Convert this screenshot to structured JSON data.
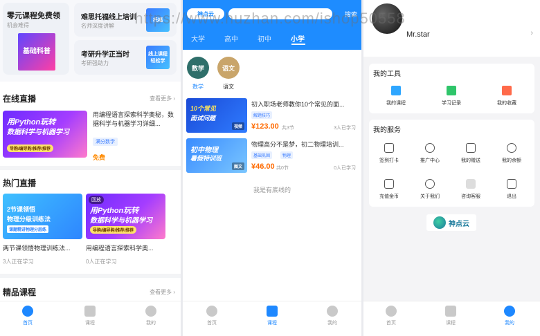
{
  "watermark": "https://www.huzhan.com/ishop50558",
  "screen1": {
    "top_cards": {
      "free": {
        "title": "零元课程免费领",
        "sub": "机会难得",
        "img": "基础科普"
      },
      "a": {
        "title": "难思托福线上培训",
        "sub": "名师深度讲解",
        "img": "托福"
      },
      "b": {
        "title": "考研升学正当时",
        "sub": "考研强助力",
        "img": "线上课程 轻松学"
      }
    },
    "live": {
      "heading": "在线直播",
      "more": "查看更多 ›",
      "thumb_l1": "用Python玩转",
      "thumb_l2": "数据科学与机器学习",
      "thumb_tags": "导购/编导购/推荐/推荐",
      "title": "用编程语言探索科学奥秘，数据科学与机器学习详细...",
      "tag": "满分数学",
      "price": "免费"
    },
    "hot": {
      "heading": "热门直播",
      "card1": {
        "p1": "2节课领悟",
        "p2": "物理分级训练法",
        "p3": "课题精讲物理分层练",
        "title": "两节课领悟物理训练法...",
        "count": "3人正在学习"
      },
      "card2": {
        "replay": "回放",
        "l1": "用Python玩转",
        "l2": "数据科学与机器学习",
        "tags": "导购/编导购/推荐/推荐",
        "title": "用编程语言探索科学奥...",
        "count": "0人正在学习"
      }
    },
    "premium": {
      "heading": "精品课程",
      "more": "查看更多 ›"
    },
    "tabs": [
      "首页",
      "课程",
      "我的"
    ]
  },
  "screen2": {
    "logo": "神点云",
    "search_placeholder": "",
    "search_btn": "搜索",
    "levels": [
      "大学",
      "高中",
      "初中",
      "小学"
    ],
    "subjects": [
      {
        "name": "数学",
        "color": "#2f6f6a"
      },
      {
        "name": "语文",
        "color": "#c9a56a"
      }
    ],
    "courses": [
      {
        "thumb1": "10个常见",
        "thumb2": "面试问题",
        "thumb_tag": "视频",
        "title": "初入职场老师教你10个常见的面...",
        "tag": "解题技巧",
        "tag2": "",
        "price": "¥123.00",
        "lessons": "共3节",
        "learn": "3人已学习"
      },
      {
        "thumb1": "初中物理",
        "thumb2": "暑假特训班",
        "thumb_tag": "图文",
        "title": "物理高分不是梦，初二物理培训...",
        "tag": "基础巩固",
        "tag2": "物理",
        "price": "¥46.00",
        "lessons": "共0节",
        "learn": "0人已学习"
      }
    ],
    "bottom_line": "我是有底线的",
    "tabs": [
      "首页",
      "课程",
      "我的"
    ]
  },
  "screen3": {
    "username": "Mr.star",
    "tools_title": "我的工具",
    "tools": [
      "我的课程",
      "学习记录",
      "我的收藏"
    ],
    "services_title": "我的服务",
    "services_row1": [
      "签到打卡",
      "推广中心",
      "我的赠送",
      "我的余额"
    ],
    "services_row2": [
      "充值金币",
      "关于我们",
      "咨询客服",
      "退出"
    ],
    "brand_name": "神点云",
    "tabs": [
      "首页",
      "课程",
      "我的"
    ]
  }
}
